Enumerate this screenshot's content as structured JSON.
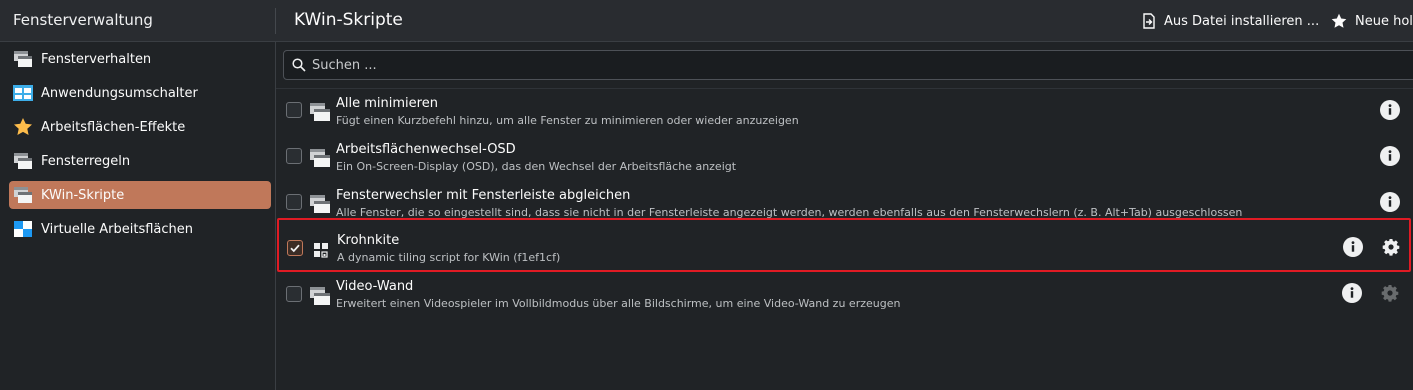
{
  "header": {
    "left_title": "Fensterverwaltung",
    "page_title": "KWin-Skripte",
    "install_label": "Aus Datei installieren ...",
    "new_label": "Neue hole"
  },
  "sidebar": {
    "items": [
      {
        "label": "Fensterverhalten",
        "icon": "window-icon"
      },
      {
        "label": "Anwendungsumschalter",
        "icon": "task-switcher-icon"
      },
      {
        "label": "Arbeitsflächen-Effekte",
        "icon": "star-icon"
      },
      {
        "label": "Fensterregeln",
        "icon": "window-icon"
      },
      {
        "label": "KWin-Skripte",
        "icon": "window-icon",
        "active": true
      },
      {
        "label": "Virtuelle Arbeitsflächen",
        "icon": "virtual-desktops-icon"
      }
    ]
  },
  "search": {
    "placeholder": "Suchen ..."
  },
  "scripts": [
    {
      "title": "Alle minimieren",
      "description": "Fügt einen Kurzbefehl hinzu, um alle Fenster zu minimieren oder wieder anzuzeigen",
      "checked": false
    },
    {
      "title": "Arbeitsflächenwechsel-OSD",
      "description": "Ein On-Screen-Display (OSD), das den Wechsel der Arbeitsfläche anzeigt",
      "checked": false
    },
    {
      "title": "Fensterwechsler mit Fensterleiste abgleichen",
      "description": "Alle Fenster, die so eingestellt sind, dass sie nicht in der Fensterleiste angezeigt werden, werden ebenfalls aus den Fensterwechslern (z. B. Alt+Tab) ausgeschlossen",
      "checked": false
    },
    {
      "title": "Krohnkite",
      "description": "A dynamic tiling script for KWin (f1ef1cf)",
      "checked": true
    },
    {
      "title": "Video-Wand",
      "description": "Erweitert einen Videospieler im Vollbildmodus über alle Bildschirme, um eine Video-Wand zu erzeugen",
      "checked": false
    }
  ],
  "colors": {
    "accent": "#c0785a",
    "highlight_border": "#e01b24",
    "background": "#202326"
  }
}
